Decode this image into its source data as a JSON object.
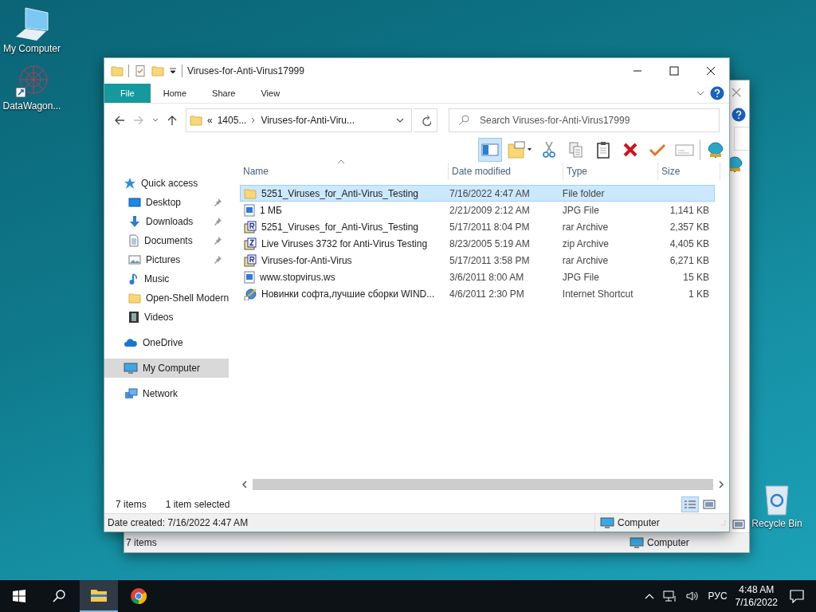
{
  "desktop_icons": [
    {
      "label": "My Computer",
      "kind": "computer"
    },
    {
      "label": "DataWagon...",
      "kind": "network-graph"
    }
  ],
  "recycle_bin": {
    "label": "Recycle Bin"
  },
  "back_window": {
    "status_bar": {
      "count": "7 items",
      "location": "Computer"
    }
  },
  "window": {
    "title": "Viruses-for-Anti-Virus17999",
    "ribbon_tabs": [
      {
        "label": "File",
        "selected": true
      },
      {
        "label": "Home",
        "selected": false
      },
      {
        "label": "Share",
        "selected": false
      },
      {
        "label": "View",
        "selected": false
      }
    ],
    "address": {
      "overflow": "«",
      "segments": [
        "1405...",
        "Viruses-for-Anti-Viru..."
      ]
    },
    "search": {
      "placeholder": "Search Viruses-for-Anti-Virus17999"
    },
    "toolbar": [
      {
        "kind": "pane",
        "selected": true
      },
      {
        "kind": "new-folder",
        "selected": false
      },
      {
        "kind": "cut",
        "selected": false
      },
      {
        "kind": "copy",
        "selected": false
      },
      {
        "kind": "paste",
        "selected": false
      },
      {
        "kind": "delete",
        "selected": false
      },
      {
        "kind": "check",
        "selected": false
      },
      {
        "kind": "envelope",
        "selected": false
      },
      {
        "kind": "shell",
        "selected": false
      }
    ],
    "nav": [
      {
        "label": "Quick access",
        "kind": "star",
        "selected": false,
        "children": [
          {
            "label": "Desktop",
            "kind": "desktop",
            "pinned": true,
            "selected": false
          },
          {
            "label": "Downloads",
            "kind": "download",
            "pinned": true,
            "selected": false
          },
          {
            "label": "Documents",
            "kind": "document",
            "pinned": true,
            "selected": false
          },
          {
            "label": "Pictures",
            "kind": "picture",
            "pinned": true,
            "selected": false
          },
          {
            "label": "Music",
            "kind": "music",
            "pinned": false,
            "selected": false
          },
          {
            "label": "Open-Shell Modern",
            "kind": "folder",
            "pinned": false,
            "selected": false
          },
          {
            "label": "Videos",
            "kind": "video",
            "pinned": false,
            "selected": false
          }
        ]
      },
      {
        "label": "OneDrive",
        "kind": "cloud",
        "selected": false
      },
      {
        "label": "My Computer",
        "kind": "computer",
        "selected": true
      },
      {
        "label": "Network",
        "kind": "network",
        "selected": false
      }
    ],
    "table": {
      "columns": [
        {
          "label": "Name",
          "sorted": true
        },
        {
          "label": "Date modified",
          "sorted": false
        },
        {
          "label": "Type",
          "sorted": false
        },
        {
          "label": "Size",
          "sorted": false
        }
      ],
      "rows": [
        {
          "name": "5251_Viruses_for_Anti-Virus_Testing",
          "kind": "folder",
          "date": "7/16/2022 4:47 AM",
          "type": "File folder",
          "selected": true
        },
        {
          "name": "1 МБ",
          "kind": "image",
          "date": "2/21/2009 2:12 AM",
          "type": "JPG File",
          "size": "1,141 KB",
          "selected": false
        },
        {
          "name": "5251_Viruses_for_Anti-Virus_Testing",
          "kind": "rar",
          "date": "5/17/2011 8:04 PM",
          "type": "rar Archive",
          "size": "2,357 KB",
          "selected": false
        },
        {
          "name": "Live Viruses 3732 for Anti-Virus Testing",
          "kind": "zip",
          "date": "8/23/2005 5:19 AM",
          "type": "zip Archive",
          "size": "4,405 KB",
          "selected": false
        },
        {
          "name": "Viruses-for-Anti-Virus",
          "kind": "rar",
          "date": "5/17/2011 3:58 PM",
          "type": "rar Archive",
          "size": "6,271 KB",
          "selected": false
        },
        {
          "name": "www.stopvirus.ws",
          "kind": "image",
          "date": "3/6/2011 8:00 AM",
          "type": "JPG File",
          "size": "15 KB",
          "selected": false
        },
        {
          "name": "Новинки софта,лучшие сборки WIND...",
          "kind": "shortcut",
          "date": "4/6/2011 2:30 PM",
          "type": "Internet Shortcut",
          "size": "1 KB",
          "selected": false
        }
      ]
    },
    "status": {
      "count": "7 items",
      "selection": "1 item selected"
    },
    "views": [
      {
        "kind": "details",
        "selected": true
      },
      {
        "kind": "large",
        "selected": false
      }
    ],
    "details_bar": {
      "info": "Date created: 7/16/2022 4:47 AM",
      "location": "Computer"
    }
  },
  "taskbar": {
    "apps": [
      {
        "kind": "explorer",
        "selected": true
      },
      {
        "kind": "chrome",
        "selected": false
      }
    ],
    "tray": {
      "language": "РУС",
      "time": "4:48 AM",
      "date": "7/16/2022"
    }
  }
}
